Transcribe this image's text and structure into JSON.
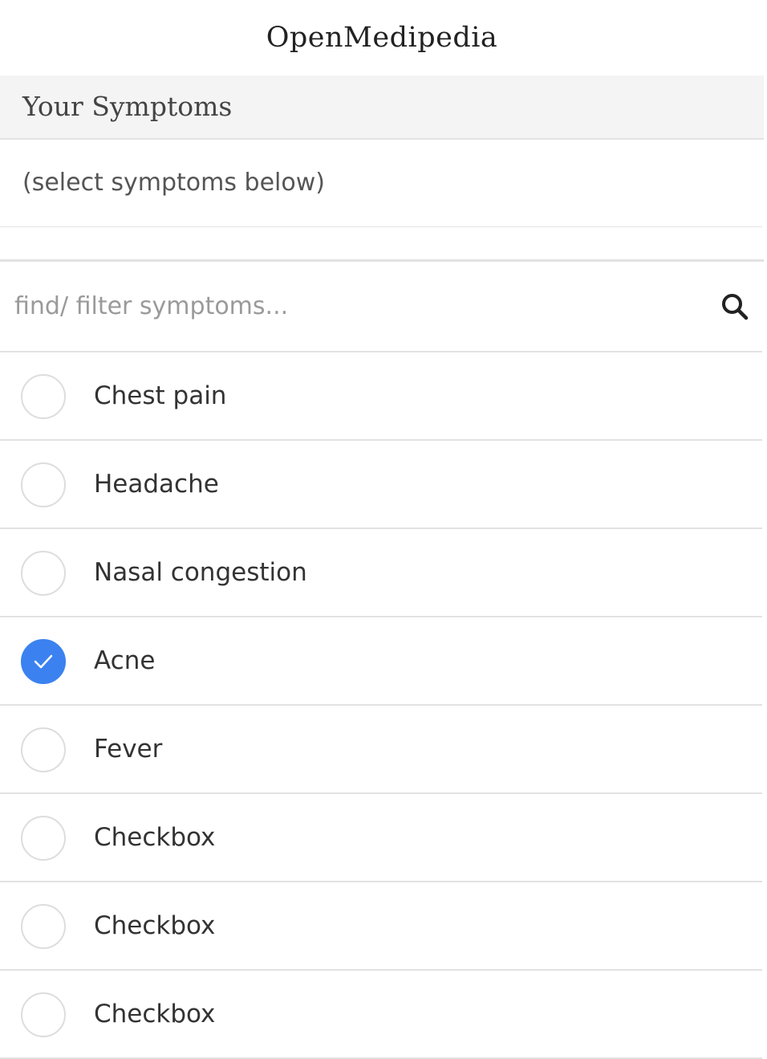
{
  "app": {
    "title": "OpenMedipedia"
  },
  "your_symptoms": {
    "heading": "Your Symptoms",
    "selected_text": "(select symptoms below)"
  },
  "search": {
    "placeholder": "find/ filter symptoms...",
    "value": "",
    "icon": "search-icon"
  },
  "colors": {
    "accent": "#3b82f0",
    "divider": "#e2e2e2",
    "header_bg": "#f4f4f4"
  },
  "symptoms": [
    {
      "label": "Chest pain",
      "checked": false
    },
    {
      "label": "Headache",
      "checked": false
    },
    {
      "label": "Nasal congestion",
      "checked": false
    },
    {
      "label": "Acne",
      "checked": true
    },
    {
      "label": "Fever",
      "checked": false
    },
    {
      "label": "Checkbox",
      "checked": false
    },
    {
      "label": "Checkbox",
      "checked": false
    },
    {
      "label": "Checkbox",
      "checked": false
    }
  ]
}
